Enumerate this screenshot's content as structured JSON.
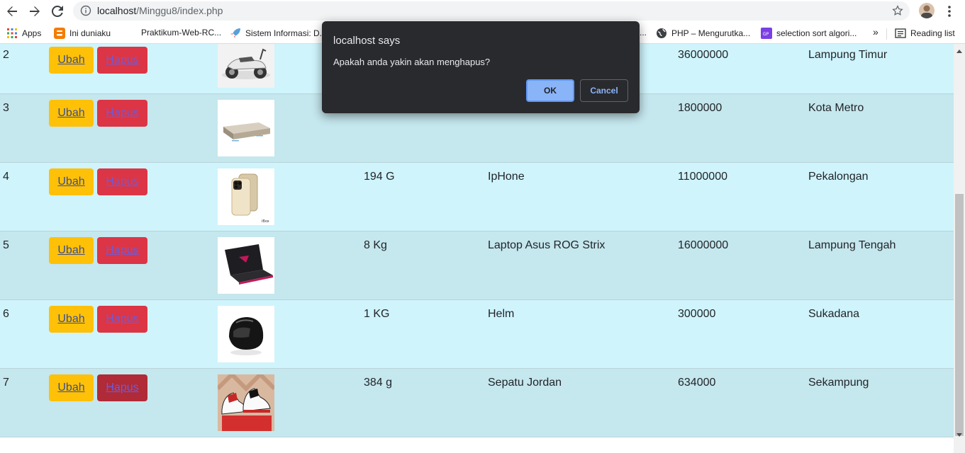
{
  "browser": {
    "url_host": "localhost",
    "url_path": "/Minggu8/index.php",
    "bookmarks": [
      {
        "label": "Apps"
      },
      {
        "label": "Ini duniaku"
      },
      {
        "label": "Praktikum-Web-RC..."
      },
      {
        "label": "Sistem Informasi: D..."
      },
      {
        "label": "..."
      },
      {
        "label": "PHP – Mengurutka..."
      },
      {
        "label": "selection sort algori..."
      },
      {
        "label": "»"
      },
      {
        "label": "Reading list"
      }
    ]
  },
  "table": {
    "action_labels": {
      "edit": "Ubah",
      "delete": "Hapus"
    },
    "rows": [
      {
        "no": "2",
        "weight": "",
        "name": "",
        "price": "36000000",
        "location": "Lampung Timur",
        "image": "motor-scooter"
      },
      {
        "no": "3",
        "weight": "",
        "name": "",
        "price": "1800000",
        "location": "Kota Metro",
        "image": "mattress"
      },
      {
        "no": "4",
        "weight": "194 G",
        "name": "IpHone",
        "price": "11000000",
        "location": "Pekalongan",
        "image": "iphone"
      },
      {
        "no": "5",
        "weight": "8 Kg",
        "name": "Laptop Asus ROG Strix",
        "price": "16000000",
        "location": "Lampung Tengah",
        "image": "laptop"
      },
      {
        "no": "6",
        "weight": "1 KG",
        "name": "Helm",
        "price": "300000",
        "location": "Sukadana",
        "image": "helmet"
      },
      {
        "no": "7",
        "weight": "384 g",
        "name": "Sepatu Jordan",
        "price": "634000",
        "location": "Sekampung",
        "image": "sneakers"
      }
    ]
  },
  "dialog": {
    "title": "localhost says",
    "message": "Apakah anda yakin akan menghapus?",
    "ok_label": "OK",
    "cancel_label": "Cancel"
  },
  "colors": {
    "row_light": "#cff4fc",
    "row_dark": "#c5e7ee",
    "edit_button": "#ffc107",
    "delete_button": "#dc3545",
    "dialog_bg": "#292a2d",
    "dialog_ok": "#8ab4f8"
  }
}
